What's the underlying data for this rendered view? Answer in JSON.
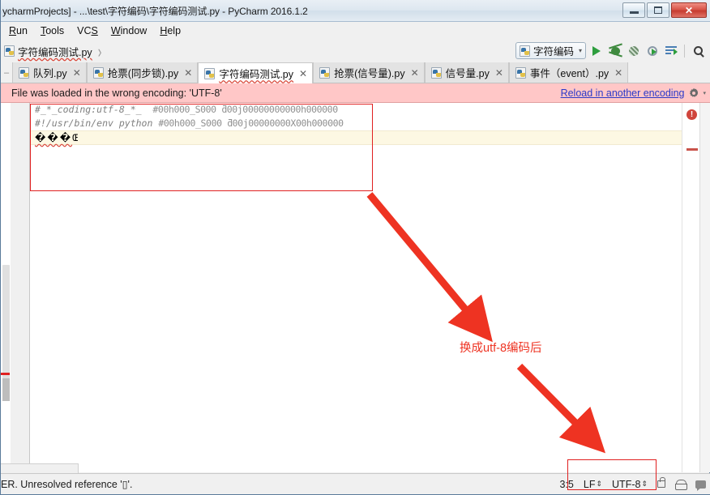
{
  "window": {
    "title": "ycharmProjects] - ...\\test\\字符编码\\字符编码测试.py - PyCharm 2016.1.2",
    "minimize_label": "Minimize",
    "maximize_label": "Maximize",
    "close_label": "✕"
  },
  "menubar": {
    "items": [
      {
        "label": "Run",
        "mnemonic": "R"
      },
      {
        "label": "Tools",
        "mnemonic": "T"
      },
      {
        "label": "VCS",
        "mnemonic": "S"
      },
      {
        "label": "Window",
        "mnemonic": "W"
      },
      {
        "label": "Help",
        "mnemonic": "H"
      }
    ]
  },
  "navbar": {
    "crumb": "字符编码测试.py",
    "separator": "›"
  },
  "toolbar": {
    "run_config": "字符编码",
    "run_config_caret": "▾",
    "icons": [
      "run-icon",
      "debug-icon",
      "coverage-icon",
      "profile-icon",
      "edit-configurations-icon",
      "search-everywhere-icon"
    ]
  },
  "tabs": [
    {
      "label": "队列.py",
      "active": false,
      "close": "✕"
    },
    {
      "label": "抢票(同步锁).py",
      "active": false,
      "close": "✕"
    },
    {
      "label": "字符编码测试.py",
      "active": true,
      "close": "✕"
    },
    {
      "label": "抢票(信号量).py",
      "active": false,
      "close": "✕"
    },
    {
      "label": "信号量.py",
      "active": false,
      "close": "✕"
    },
    {
      "label": "事件（event）.py",
      "active": false,
      "close": "✕"
    }
  ],
  "notification": {
    "message": "File was loaded in the wrong encoding: 'UTF-8'",
    "link": "Reload in another encoding",
    "gear_caret": "▾"
  },
  "editor": {
    "lines": [
      {
        "prefix": "#_*_coding:utf-8_*_  ",
        "mojibake": "#00h000_S000 ƌ00j00000000000h000000"
      },
      {
        "prefix": "#!/usr/bin/env python ",
        "mojibake": "#00h000_S000 ƌ00j00000000X00h000000"
      }
    ],
    "caret_line": "���",
    "caret_line_trailing": "Œ"
  },
  "gutter": {
    "error_badge": "!"
  },
  "annotations": {
    "label": "换成utf-8编码后",
    "color": "#ee3322"
  },
  "statusbar": {
    "message": "ER. Unresolved reference '▯'.",
    "position": "3:5",
    "line_separator": "LF",
    "encoding": "UTF-8",
    "updown_glyph": "⇕",
    "icons": [
      "lock-icon",
      "hector-icon",
      "notifications-icon"
    ]
  }
}
